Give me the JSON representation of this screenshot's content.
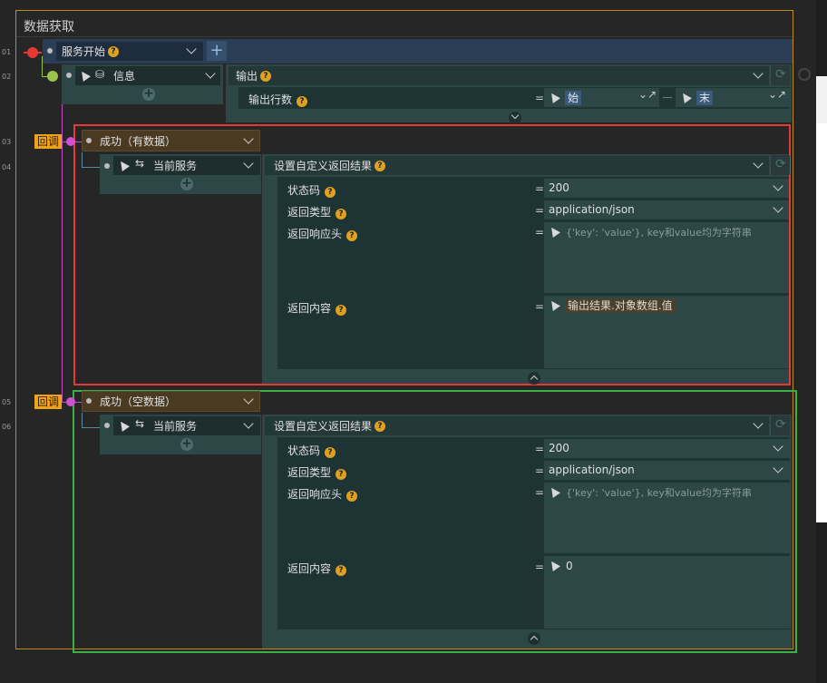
{
  "window": {
    "title": "数据获取"
  },
  "line_numbers": [
    "01",
    "02",
    "03",
    "04",
    "05",
    "06"
  ],
  "root": {
    "label": "服务开始"
  },
  "info": {
    "label": "信息"
  },
  "output": {
    "label": "输出",
    "row_count_label": "输出行数",
    "start_tag": "始",
    "end_tag": "末"
  },
  "callback_badge": "回调",
  "success_data": {
    "label": "成功（有数据）",
    "service": "当前服务",
    "action": "设置自定义返回结果",
    "status_code_label": "状态码",
    "status_code_value": "200",
    "return_type_label": "返回类型",
    "return_type_value": "application/json",
    "headers_label": "返回响应头",
    "headers_placeholder": "{'key': 'value'}, key和value均为字符串",
    "content_label": "返回内容",
    "content_value": "输出结果.对象数组.值"
  },
  "success_empty": {
    "label": "成功（空数据）",
    "service": "当前服务",
    "action": "设置自定义返回结果",
    "status_code_label": "状态码",
    "status_code_value": "200",
    "return_type_label": "返回类型",
    "return_type_value": "application/json",
    "headers_label": "返回响应头",
    "headers_placeholder": "{'key': 'value'}, key和value均为字符串",
    "content_label": "返回内容",
    "content_value": "0"
  },
  "colors": {
    "highlight_red": "#e53935",
    "highlight_green": "#3cb043",
    "frame": "#c08a1a",
    "badge": "#f0a318"
  }
}
